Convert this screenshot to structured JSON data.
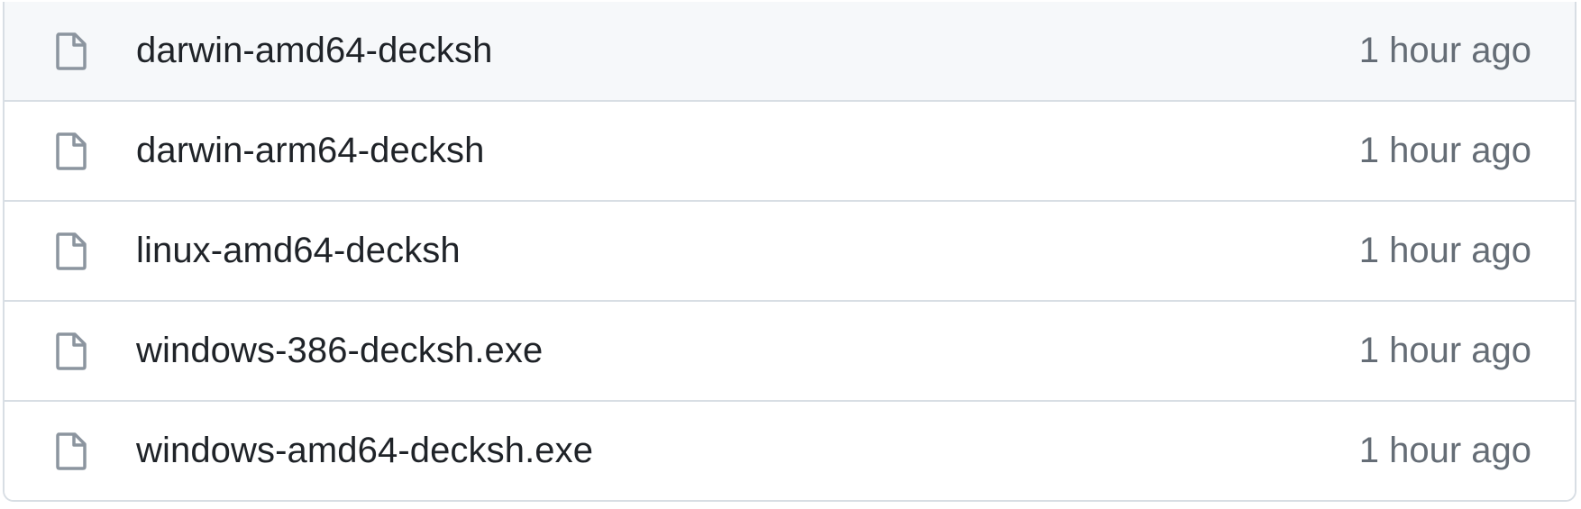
{
  "file_list": {
    "items": [
      {
        "name": "darwin-amd64-decksh",
        "age": "1 hour ago",
        "icon": "file-icon",
        "hovered": true
      },
      {
        "name": "darwin-arm64-decksh",
        "age": "1 hour ago",
        "icon": "file-icon",
        "hovered": false
      },
      {
        "name": "linux-amd64-decksh",
        "age": "1 hour ago",
        "icon": "file-icon",
        "hovered": false
      },
      {
        "name": "windows-386-decksh.exe",
        "age": "1 hour ago",
        "icon": "file-icon",
        "hovered": false
      },
      {
        "name": "windows-amd64-decksh.exe",
        "age": "1 hour ago",
        "icon": "file-icon",
        "hovered": false
      }
    ]
  },
  "colors": {
    "text": "#1f2328",
    "muted": "#656d76",
    "border": "#d8dee4",
    "hover_bg": "#f6f8fa",
    "icon": "#8c959f"
  }
}
